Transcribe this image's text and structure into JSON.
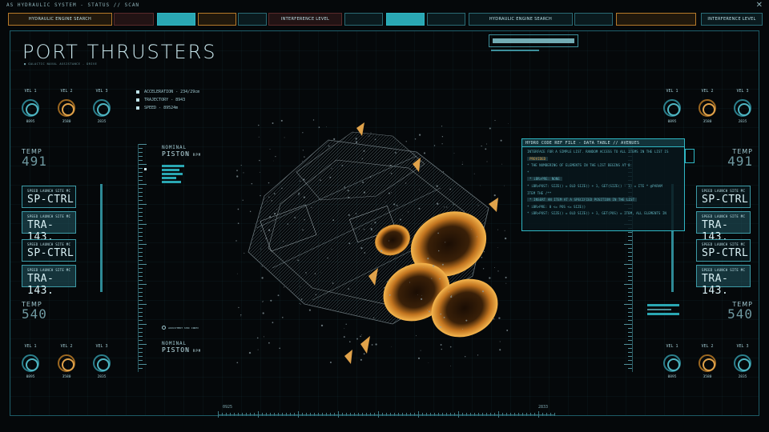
{
  "app": {
    "window_title": "AS HYDRAULIC SYSTEM - STATUS // SCAN",
    "close_glyph": "✕"
  },
  "topbar": {
    "items": [
      {
        "label": "HYDRAULIC ENGINE SEARCH",
        "style": "orange"
      },
      {
        "label": "",
        "style": "red"
      },
      {
        "label": "",
        "style": "cyan"
      },
      {
        "label": "",
        "style": "orange"
      },
      {
        "label": "",
        "style": "dark"
      },
      {
        "label": "INTERFERENCE LEVEL",
        "style": "red"
      },
      {
        "label": "",
        "style": "dark"
      },
      {
        "label": "",
        "style": "cyan"
      },
      {
        "label": "",
        "style": "dark"
      },
      {
        "label": "HYDRAULIC ENGINE SEARCH",
        "style": "dark"
      },
      {
        "label": "",
        "style": "dark"
      },
      {
        "label": "",
        "style": "orange"
      },
      {
        "label": "INTERFERENCE LEVEL",
        "style": "dark"
      }
    ]
  },
  "page": {
    "title": "PORT THRUSTERS",
    "subtitle": "■ GALACTIC NAVAL ASSISTANCE - DRIVE"
  },
  "gauges": {
    "top_left": [
      {
        "label": "VEL 1",
        "value": "0895",
        "color": "cyan"
      },
      {
        "label": "VEL 2",
        "value": "3580",
        "color": "orange"
      },
      {
        "label": "VEL 3",
        "value": "2835",
        "color": "cyan"
      }
    ],
    "top_right": [
      {
        "label": "VEL 1",
        "value": "0895",
        "color": "cyan"
      },
      {
        "label": "VEL 2",
        "value": "3580",
        "color": "orange"
      },
      {
        "label": "VEL 3",
        "value": "2835",
        "color": "cyan"
      }
    ],
    "bottom_left": [
      {
        "label": "VEL 1",
        "value": "0895",
        "color": "cyan"
      },
      {
        "label": "VEL 2",
        "value": "3580",
        "color": "orange"
      },
      {
        "label": "VEL 3",
        "value": "2835",
        "color": "cyan"
      }
    ],
    "bottom_right": [
      {
        "label": "VEL 1",
        "value": "0895",
        "color": "cyan"
      },
      {
        "label": "VEL 2",
        "value": "3580",
        "color": "orange"
      },
      {
        "label": "VEL 3",
        "value": "2835",
        "color": "cyan"
      }
    ]
  },
  "stats": [
    {
      "label": "ACCELERATION - 234/29cm"
    },
    {
      "label": "TRAJECTORY - 8943"
    },
    {
      "label": "SPEED - 89524m"
    }
  ],
  "temps": {
    "left_top": {
      "label": "TEMP",
      "value": "491"
    },
    "left_bottom": {
      "label": "TEMP",
      "value": "540"
    },
    "right_top": {
      "label": "TEMP",
      "value": "491"
    },
    "right_bottom": {
      "label": "TEMP",
      "value": "540"
    }
  },
  "speed_boxes": {
    "left": [
      {
        "label": "SPEED LAUNCH SITE MC",
        "value": "SP-CTRL"
      },
      {
        "label": "SPEED LAUNCH SITE MC",
        "value": "TRA-143."
      },
      {
        "label": "SPEED LAUNCH SITE MC",
        "value": "SP-CTRL"
      },
      {
        "label": "SPEED LAUNCH SITE MC",
        "value": "TRA-143."
      }
    ],
    "right": [
      {
        "label": "SPEED LAUNCH SITE MC",
        "value": "SP-CTRL"
      },
      {
        "label": "SPEED LAUNCH SITE MC",
        "value": "TRA-143."
      },
      {
        "label": "SPEED LAUNCH SITE MC",
        "value": "SP-CTRL"
      },
      {
        "label": "SPEED LAUNCH SITE MC",
        "value": "TRA-143."
      }
    ]
  },
  "nominal": {
    "top": {
      "label": "NOMINAL",
      "piston": "PISTON",
      "unit": "RPM"
    },
    "bottom": {
      "label": "NOMINAL",
      "piston": "PISTON",
      "unit": "RPM"
    },
    "mini_caption": "ADJUSTMENT SYNC INDEX"
  },
  "code_panel": {
    "header": "HYDRO CODE REF FILE - DATA TABLE // AVENUES",
    "lines": [
      {
        "text": "INTERFACE FOR A SIMPLE LIST. RANDOM ACCESS TO ALL ITEMS IN THE LIST IS",
        "hl": false
      },
      {
        "text": "PROVIDED",
        "hl": true,
        "box": true
      },
      {
        "text": "* THE NUMBERING OF ELEMENTS IN THE LIST BEGINS AT 0.",
        "hl": false
      },
      {
        "text": "*",
        "hl": false
      },
      {
        "text": "* iBR>PRE: NONE",
        "hl": false,
        "box": true
      },
      {
        "text": "* iBR>POST: SIZE() = OLD SIZE() + 1, GET(SIZE() - 1) = ITE * @PARAM",
        "hl": false
      },
      {
        "text": "ITEM THE /**",
        "hl": false
      },
      {
        "text": "* INSERT AN ITEM AT A SPECIFIED POSITION IN THE LIST",
        "hl": false,
        "box": true
      },
      {
        "text": "* iBR>PRE: 0 <= POS <= SIZE()",
        "hl": false
      },
      {
        "text": "* iBR>POST: SIZE() = OLD SIZE() + 1, GET(POS) = ITEM, ALL ELEMENTS IN",
        "hl": false
      }
    ]
  },
  "bottom_scale": {
    "start": "0925",
    "end": "2833"
  },
  "colors": {
    "accent": "#2aa7b3",
    "orange": "#e0a24a",
    "background": "#05080a",
    "frame": "#1d5a66"
  }
}
